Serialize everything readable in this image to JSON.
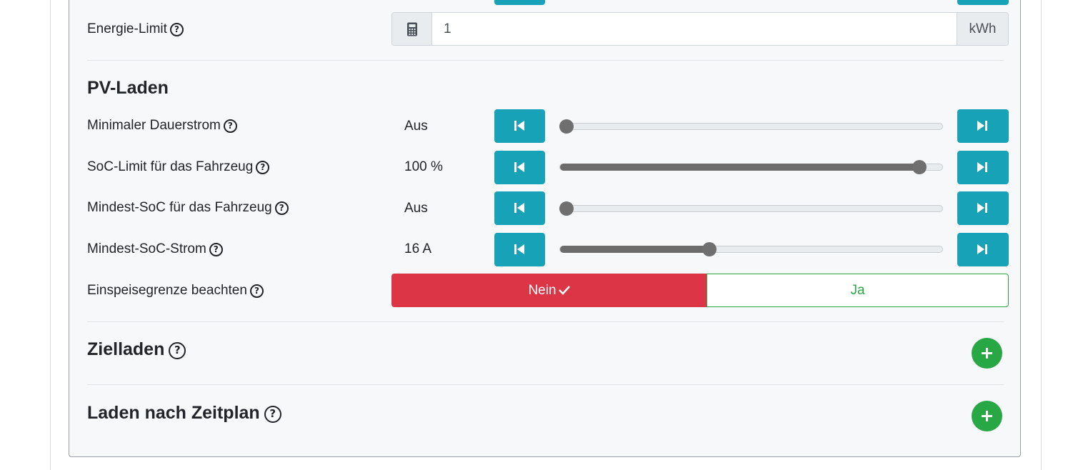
{
  "energy_limit": {
    "label": "Energie-Limit",
    "value": "1",
    "unit": "kWh",
    "icon": "calculator-icon"
  },
  "pv_section": {
    "title": "PV-Laden",
    "rows": [
      {
        "label": "Minimaler Dauerstrom",
        "value": "Aus",
        "level": 0
      },
      {
        "label": "SoC-Limit für das Fahrzeug",
        "value": "100 %",
        "level": 0.94
      },
      {
        "label": "Mindest-SoC für das Fahrzeug",
        "value": "Aus",
        "level": 0
      },
      {
        "label": "Mindest-SoC-Strom",
        "value": "16 A",
        "level": 0.39
      }
    ],
    "feed_in": {
      "label": "Einspeisegrenze beachten",
      "no": "Nein",
      "yes": "Ja",
      "selected": "no"
    }
  },
  "target_charging": {
    "title": "Zielladen"
  },
  "schedule_charging": {
    "title": "Laden nach Zeitplan"
  },
  "colors": {
    "accent": "#17a2b8",
    "danger": "#dc3545",
    "success": "#28a745"
  }
}
